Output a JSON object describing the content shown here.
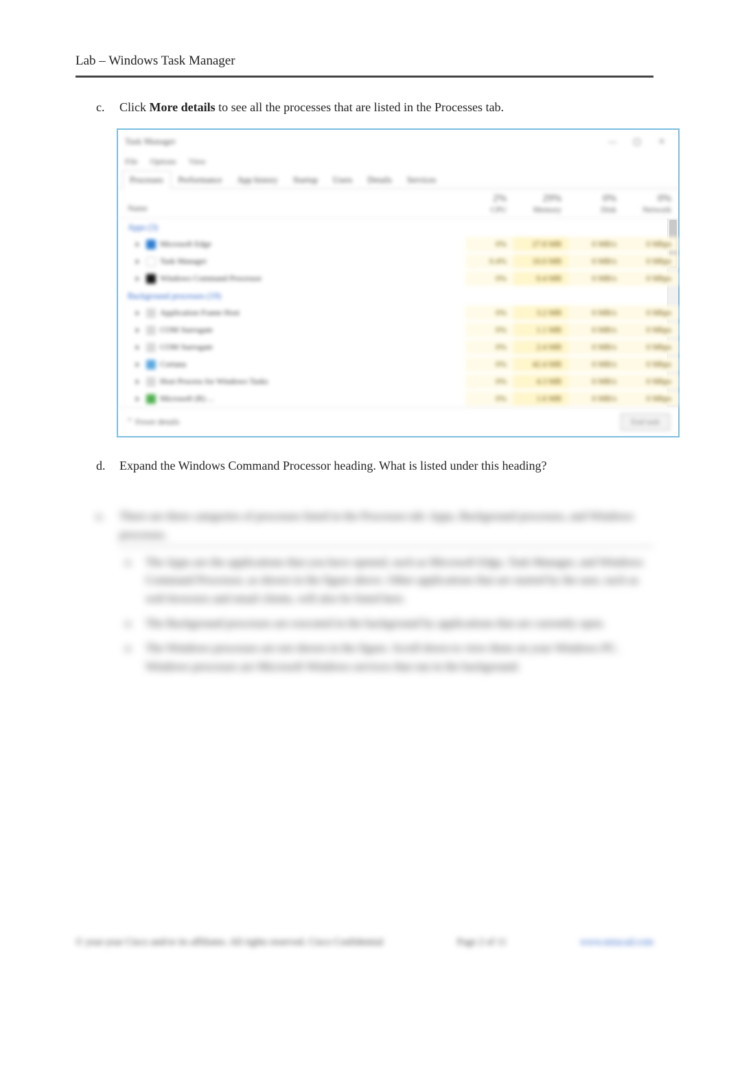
{
  "header": {
    "title": "Lab – Windows Task Manager"
  },
  "steps": {
    "c": {
      "letter": "c.",
      "text_prefix": "Click ",
      "bold": "More details",
      "text_suffix": " to see all the processes that are listed in the Processes tab."
    },
    "d": {
      "letter": "d.",
      "text": "Expand the Windows Command Processor heading. What is listed under this heading?"
    }
  },
  "taskmanager": {
    "title": "Task Manager",
    "menus": [
      "File",
      "Options",
      "View"
    ],
    "window_buttons": {
      "min": "—",
      "max": "▢",
      "close": "✕"
    },
    "tabs": [
      "Processes",
      "Performance",
      "App history",
      "Startup",
      "Users",
      "Details",
      "Services"
    ],
    "columns": {
      "name": "Name",
      "cpu": {
        "pct": "2%",
        "label": "CPU"
      },
      "mem": {
        "pct": "29%",
        "label": "Memory"
      },
      "disk": {
        "pct": "0%",
        "label": "Disk"
      },
      "net": {
        "pct": "0%",
        "label": "Network"
      }
    },
    "sections": {
      "apps": "Apps (3)",
      "bg": "Background processes (19)"
    },
    "apps": [
      {
        "icon": "ic-edge",
        "name": "Microsoft Edge",
        "cpu": "0%",
        "mem": "27.8 MB",
        "disk": "0 MB/s",
        "net": "0 Mbps"
      },
      {
        "icon": "ic-notes",
        "name": "Task Manager",
        "cpu": "0.4%",
        "mem": "10.0 MB",
        "disk": "0 MB/s",
        "net": "0 Mbps"
      },
      {
        "icon": "ic-cmd",
        "name": "Windows Command Processor",
        "cpu": "0%",
        "mem": "0.4 MB",
        "disk": "0 MB/s",
        "net": "0 Mbps"
      }
    ],
    "bg": [
      {
        "icon": "ic-sys",
        "name": "Application Frame Host",
        "cpu": "0%",
        "mem": "3.2 MB",
        "disk": "0 MB/s",
        "net": "0 Mbps"
      },
      {
        "icon": "ic-sys",
        "name": "COM Surrogate",
        "cpu": "0%",
        "mem": "1.1 MB",
        "disk": "0 MB/s",
        "net": "0 Mbps"
      },
      {
        "icon": "ic-sys",
        "name": "COM Surrogate",
        "cpu": "0%",
        "mem": "2.4 MB",
        "disk": "0 MB/s",
        "net": "0 Mbps"
      },
      {
        "icon": "ic-df",
        "name": "Cortana",
        "cpu": "0%",
        "mem": "42.4 MB",
        "disk": "0 MB/s",
        "net": "0 Mbps"
      },
      {
        "icon": "ic-sys",
        "name": "Host Process for Windows Tasks",
        "cpu": "0%",
        "mem": "4.3 MB",
        "disk": "0 MB/s",
        "net": "0 Mbps"
      },
      {
        "icon": "ic-store",
        "name": "Microsoft (R) ...",
        "cpu": "0%",
        "mem": "1.6 MB",
        "disk": "0 MB/s",
        "net": "0 Mbps"
      }
    ],
    "fewer": "Fewer details",
    "endtask": "End task"
  },
  "blurred": {
    "e_letter": "e.",
    "e_text": "There are three categories of processes listed in the Processes tab: Apps, Background processes, and Windows processes.",
    "items": [
      {
        "marker": "o",
        "text": "The Apps are the applications that you have opened, such as Microsoft Edge, Task Manager, and Windows Command Processor, as shown in the figure above. Other applications that are started by the user, such as web browsers and email clients, will also be listed here."
      },
      {
        "marker": "o",
        "text": "The Background processes are executed in the background by applications that are currently open."
      },
      {
        "marker": "o",
        "text": "The Windows processes are not shown in the figure. Scroll down to view them on your Windows PC. Windows processes are Microsoft Windows services that run in the background."
      }
    ]
  },
  "footer": {
    "copyright": "© year-year Cisco and/or its affiliates. All rights reserved. Cisco Confidential",
    "page": "Page 2 of 11",
    "link": "www.netacad.com"
  }
}
